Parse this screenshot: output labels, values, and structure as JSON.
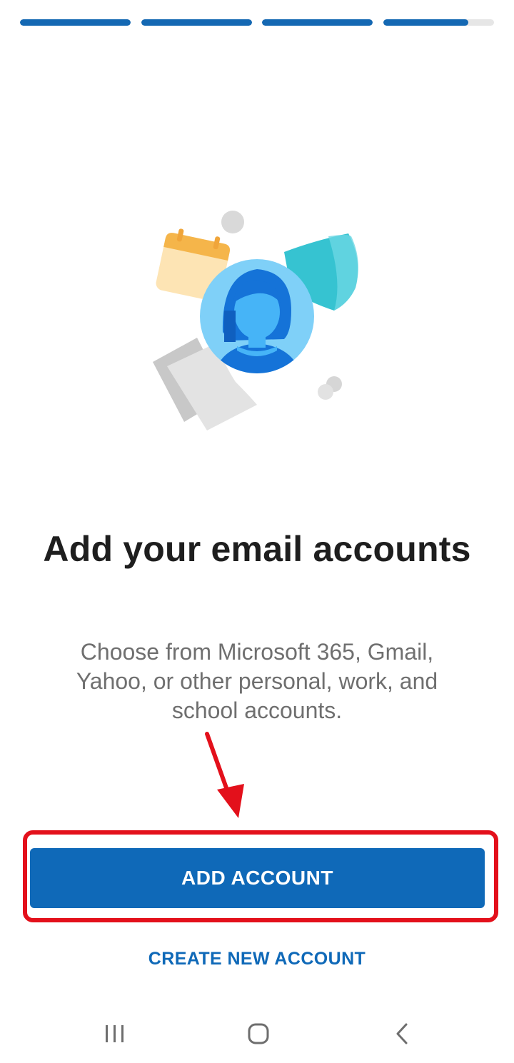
{
  "progress": {
    "steps": [
      {
        "name": "step-1",
        "filled": 1.0
      },
      {
        "name": "step-2",
        "filled": 1.0
      },
      {
        "name": "step-3",
        "filled": 1.0
      },
      {
        "name": "step-4",
        "filled": 0.77
      }
    ],
    "active_color": "#1468b3",
    "inactive_color": "#e6e6e6"
  },
  "illustration": {
    "icons": [
      "calendar-icon",
      "shield-icon",
      "person-avatar-icon",
      "document-icon"
    ]
  },
  "headline": "Add your email accounts",
  "subtitle": "Choose from Microsoft 365, Gmail, Yahoo, or other personal, work, and school accounts.",
  "buttons": {
    "add_account": "ADD ACCOUNT",
    "create_new_account": "CREATE NEW ACCOUNT"
  },
  "annotation": {
    "color": "#e3101b",
    "icons": [
      "red-arrow-icon",
      "red-highlight-box"
    ]
  },
  "navbar": {
    "icons": [
      "recent-apps-icon",
      "home-icon",
      "back-icon"
    ]
  },
  "colors": {
    "brand": "#0f69b8",
    "headline": "#1e1e1e",
    "subtitle": "#6f6f6f"
  }
}
